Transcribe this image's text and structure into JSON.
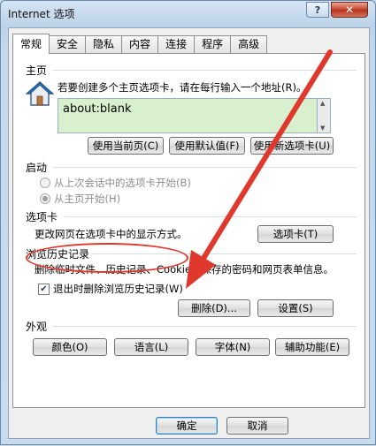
{
  "window": {
    "title": "Internet 选项",
    "help_glyph": "?",
    "close_glyph": "✕"
  },
  "tabs": [
    "常规",
    "安全",
    "隐私",
    "内容",
    "连接",
    "程序",
    "高级"
  ],
  "home": {
    "group_title": "主页",
    "description": "若要创建多个主页选项卡，请在每行输入一个地址(R)。",
    "url": "about:blank",
    "buttons": [
      "使用当前页(C)",
      "使用默认值(F)",
      "使用新选项卡(U)"
    ]
  },
  "startup": {
    "group_title": "启动",
    "options": [
      "从上次会话中的选项卡开始(B)",
      "从主页开始(H)"
    ]
  },
  "tabs_group": {
    "group_title": "选项卡",
    "description": "更改网页在选项卡中的显示方式。",
    "button": "选项卡(T)"
  },
  "history": {
    "group_title": "浏览历史记录",
    "description": "删除临时文件、历史记录、Cookie、保存的密码和网页表单信息。",
    "checkbox_label": "退出时删除浏览历史记录(W)",
    "checkbox_checked": true,
    "delete_button": "删除(D)...",
    "settings_button": "设置(S)"
  },
  "appearance": {
    "group_title": "外观",
    "buttons": [
      "颜色(O)",
      "语言(L)",
      "字体(N)",
      "辅助功能(E)"
    ]
  },
  "footer": {
    "ok": "确定",
    "cancel": "取消"
  },
  "annotation_color": "#e0382d",
  "icons": {
    "home": "house-icon",
    "help": "help-icon",
    "close": "close-icon"
  }
}
